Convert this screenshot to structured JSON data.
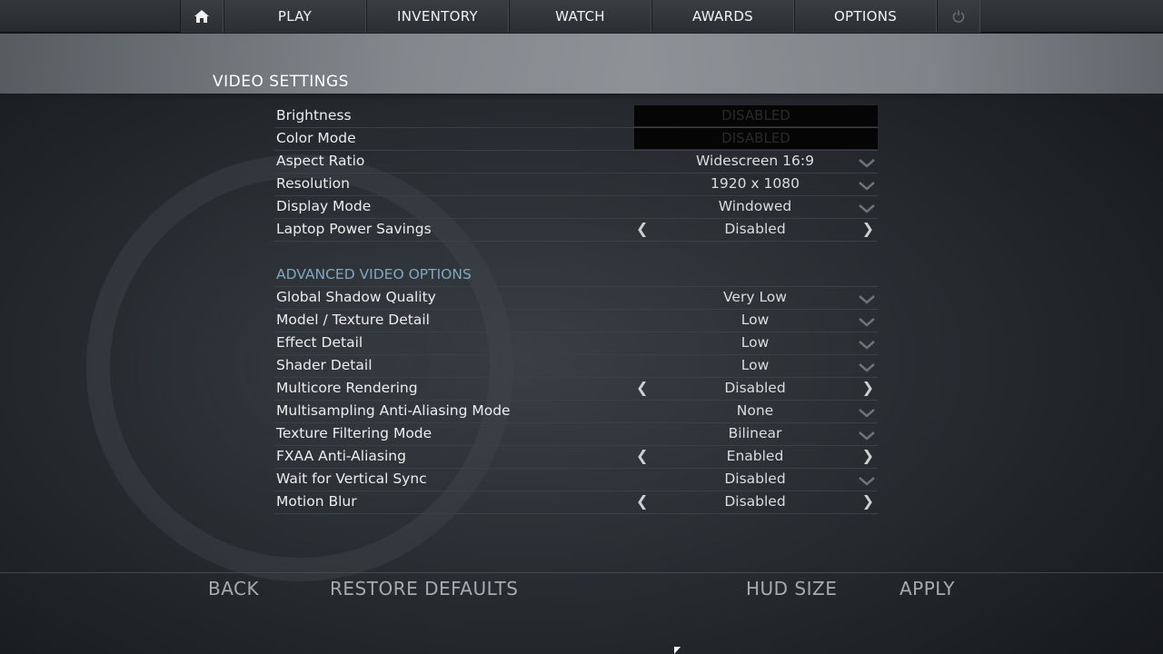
{
  "corner_number": "5",
  "nav": {
    "items": [
      "PLAY",
      "INVENTORY",
      "WATCH",
      "AWARDS",
      "OPTIONS"
    ],
    "home_icon": "home-icon",
    "power_icon": "power-icon"
  },
  "header": {
    "title": "VIDEO SETTINGS"
  },
  "basic": [
    {
      "label": "Brightness",
      "value": "DISABLED",
      "kind": "disabled"
    },
    {
      "label": "Color Mode",
      "value": "DISABLED",
      "kind": "disabled"
    },
    {
      "label": "Aspect Ratio",
      "value": "Widescreen 16:9",
      "kind": "dropdown"
    },
    {
      "label": "Resolution",
      "value": "1920 x 1080",
      "kind": "dropdown"
    },
    {
      "label": "Display Mode",
      "value": "Windowed",
      "kind": "dropdown"
    },
    {
      "label": "Laptop Power Savings",
      "value": "Disabled",
      "kind": "toggle"
    }
  ],
  "advanced": {
    "title": "ADVANCED VIDEO OPTIONS",
    "rows": [
      {
        "label": "Global Shadow Quality",
        "value": "Very Low",
        "kind": "dropdown"
      },
      {
        "label": "Model / Texture Detail",
        "value": "Low",
        "kind": "dropdown"
      },
      {
        "label": "Effect Detail",
        "value": "Low",
        "kind": "dropdown"
      },
      {
        "label": "Shader Detail",
        "value": "Low",
        "kind": "dropdown"
      },
      {
        "label": "Multicore Rendering",
        "value": "Disabled",
        "kind": "toggle"
      },
      {
        "label": "Multisampling Anti-Aliasing Mode",
        "value": "None",
        "kind": "dropdown"
      },
      {
        "label": "Texture Filtering Mode",
        "value": "Bilinear",
        "kind": "dropdown"
      },
      {
        "label": "FXAA Anti-Aliasing",
        "value": "Enabled",
        "kind": "toggle"
      },
      {
        "label": "Wait for Vertical Sync",
        "value": "Disabled",
        "kind": "dropdown"
      },
      {
        "label": "Motion Blur",
        "value": "Disabled",
        "kind": "toggle"
      }
    ]
  },
  "footer": {
    "back": "BACK",
    "restore": "RESTORE DEFAULTS",
    "hud": "HUD SIZE",
    "apply": "APPLY"
  },
  "colors": {
    "section_title": "#7fa7bf",
    "discord": "#5865f2"
  }
}
